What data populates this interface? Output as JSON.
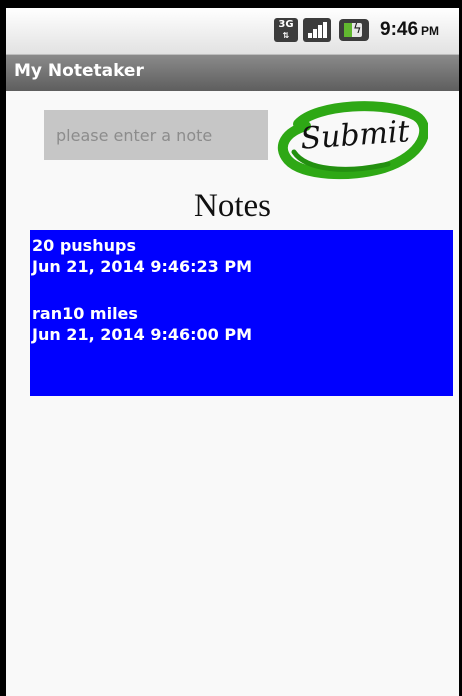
{
  "status_bar": {
    "network_type": "3G",
    "time": "9:46",
    "ampm": "PM"
  },
  "app": {
    "title": "My Notetaker"
  },
  "input": {
    "placeholder": "please enter a note",
    "value": ""
  },
  "submit": {
    "label": "Submit"
  },
  "notes": {
    "heading": "Notes",
    "items": [
      {
        "text": "20 pushups",
        "timestamp": "Jun 21, 2014 9:46:23 PM"
      },
      {
        "text": "ran10 miles",
        "timestamp": "Jun 21, 2014 9:46:00 PM"
      }
    ]
  },
  "colors": {
    "list_background": "#0000ff",
    "submit_ring": "#2ea815",
    "title_bar": "#6e6e6e"
  }
}
